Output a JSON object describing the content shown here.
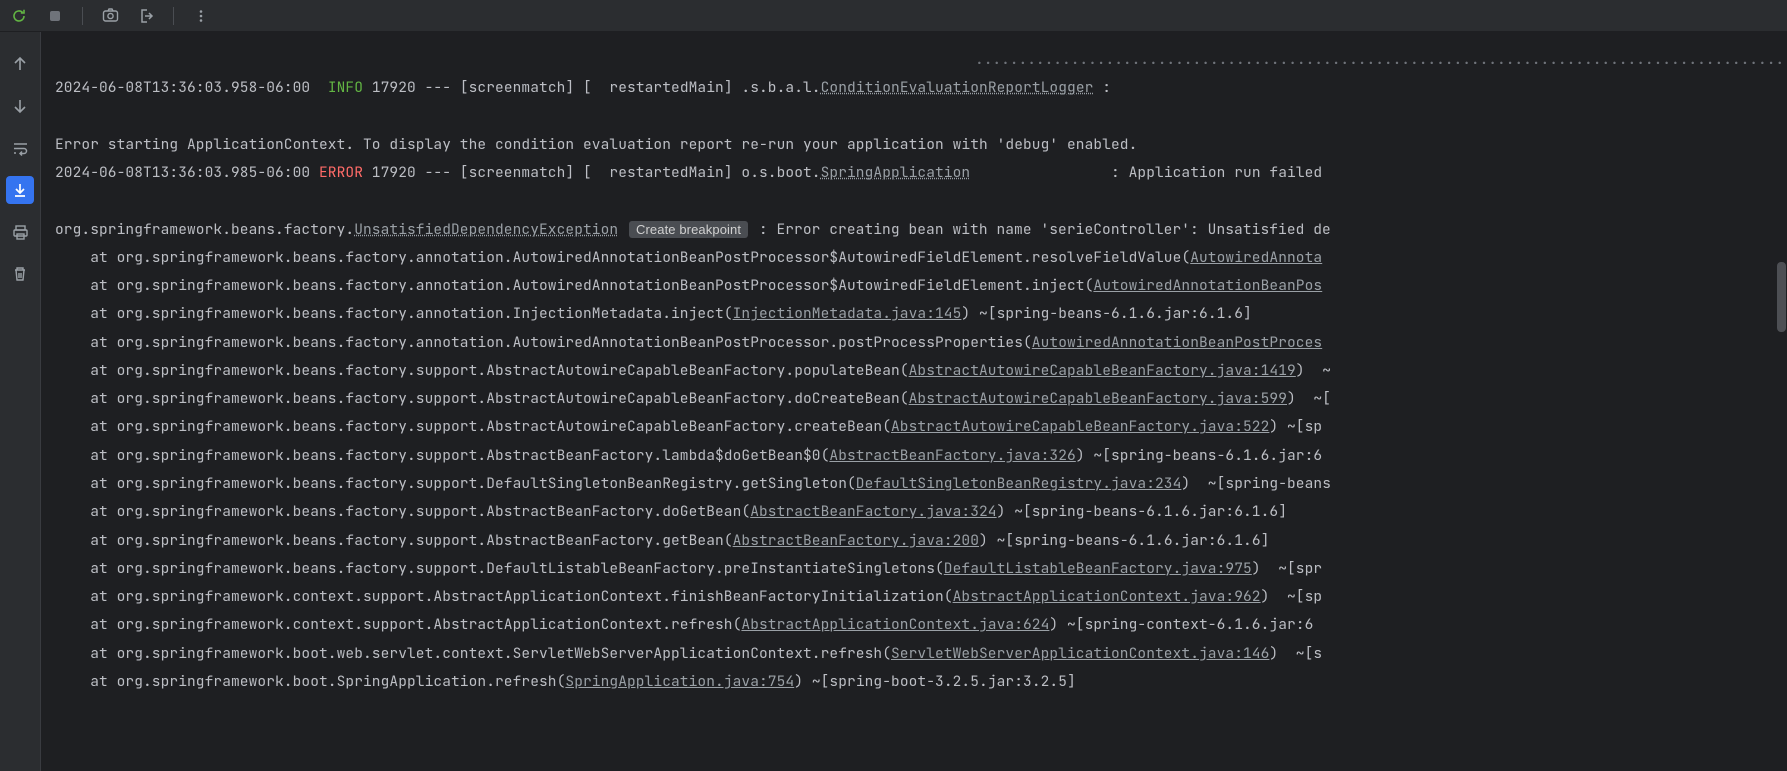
{
  "toolbar": {
    "rerun_tip": "Rerun",
    "stop_tip": "Stop"
  },
  "gutter": {
    "up_tip": "Up the Stack Trace",
    "down_tip": "Down the Stack Trace",
    "wrap_tip": "Soft-Wrap",
    "scroll_tip": "Scroll to End",
    "print_tip": "Print",
    "clear_tip": "Clear All"
  },
  "breakpoint_label": "Create breakpoint",
  "dotted_line": ".......................................................................................................................................................................",
  "log1": {
    "ts": "2024-06-08T13:36:03.958-06:00",
    "level": "INFO",
    "pid": "17920",
    "sep": "---",
    "ctx": "[screenmatch] [  restartedMain]",
    "logger": ".s.b.a.l.",
    "logger_link": "ConditionEvaluationReportLogger",
    "tail": " :"
  },
  "err_msg": "Error starting ApplicationContext. To display the condition evaluation report re-run your application with 'debug' enabled.",
  "log2": {
    "ts": "2024-06-08T13:36:03.985-06:00",
    "level": "ERROR",
    "pid": "17920",
    "sep": "---",
    "ctx": "[screenmatch] [  restartedMain]",
    "logger": "o.s.boot.",
    "logger_link": "SpringApplication",
    "spacer": "                ",
    "tail": ": Application run failed"
  },
  "exc": {
    "prefix": "org.springframework.beans.factory.",
    "name": "UnsatisfiedDependencyException",
    "msg": ": Error creating bean with name 'serieController': Unsatisfied de"
  },
  "trace": [
    {
      "pre": "    at org.springframework.beans.factory.annotation.AutowiredAnnotationBeanPostProcessor$AutowiredFieldElement.resolveFieldValue(",
      "src": "AutowiredAnnota",
      "post": ""
    },
    {
      "pre": "    at org.springframework.beans.factory.annotation.AutowiredAnnotationBeanPostProcessor$AutowiredFieldElement.inject(",
      "src": "AutowiredAnnotationBeanPos",
      "post": ""
    },
    {
      "pre": "    at org.springframework.beans.factory.annotation.InjectionMetadata.inject(",
      "src": "InjectionMetadata.java:145",
      "post": ") ~[spring-beans-6.1.6.jar:6.1.6]"
    },
    {
      "pre": "    at org.springframework.beans.factory.annotation.AutowiredAnnotationBeanPostProcessor.postProcessProperties(",
      "src": "AutowiredAnnotationBeanPostProces",
      "post": ""
    },
    {
      "pre": "    at org.springframework.beans.factory.support.AbstractAutowireCapableBeanFactory.populateBean(",
      "src": "AbstractAutowireCapableBeanFactory.java:1419",
      "post": ")  ~"
    },
    {
      "pre": "    at org.springframework.beans.factory.support.AbstractAutowireCapableBeanFactory.doCreateBean(",
      "src": "AbstractAutowireCapableBeanFactory.java:599",
      "post": ")  ~["
    },
    {
      "pre": "    at org.springframework.beans.factory.support.AbstractAutowireCapableBeanFactory.createBean(",
      "src": "AbstractAutowireCapableBeanFactory.java:522",
      "post": ") ~[sp"
    },
    {
      "pre": "    at org.springframework.beans.factory.support.AbstractBeanFactory.lambda$doGetBean$0(",
      "src": "AbstractBeanFactory.java:326",
      "post": ") ~[spring-beans-6.1.6.jar:6"
    },
    {
      "pre": "    at org.springframework.beans.factory.support.DefaultSingletonBeanRegistry.getSingleton(",
      "src": "DefaultSingletonBeanRegistry.java:234",
      "post": ")  ~[spring-beans"
    },
    {
      "pre": "    at org.springframework.beans.factory.support.AbstractBeanFactory.doGetBean(",
      "src": "AbstractBeanFactory.java:324",
      "post": ") ~[spring-beans-6.1.6.jar:6.1.6]"
    },
    {
      "pre": "    at org.springframework.beans.factory.support.AbstractBeanFactory.getBean(",
      "src": "AbstractBeanFactory.java:200",
      "post": ") ~[spring-beans-6.1.6.jar:6.1.6]"
    },
    {
      "pre": "    at org.springframework.beans.factory.support.DefaultListableBeanFactory.preInstantiateSingletons(",
      "src": "DefaultListableBeanFactory.java:975",
      "post": ")  ~[spr"
    },
    {
      "pre": "    at org.springframework.context.support.AbstractApplicationContext.finishBeanFactoryInitialization(",
      "src": "AbstractApplicationContext.java:962",
      "post": ")  ~[sp"
    },
    {
      "pre": "    at org.springframework.context.support.AbstractApplicationContext.refresh(",
      "src": "AbstractApplicationContext.java:624",
      "post": ") ~[spring-context-6.1.6.jar:6"
    },
    {
      "pre": "    at org.springframework.boot.web.servlet.context.ServletWebServerApplicationContext.refresh(",
      "src": "ServletWebServerApplicationContext.java:146",
      "post": ")  ~[s"
    },
    {
      "pre": "    at org.springframework.boot.SpringApplication.refresh(",
      "src": "SpringApplication.java:754",
      "post": ") ~[spring-boot-3.2.5.jar:3.2.5]"
    }
  ]
}
